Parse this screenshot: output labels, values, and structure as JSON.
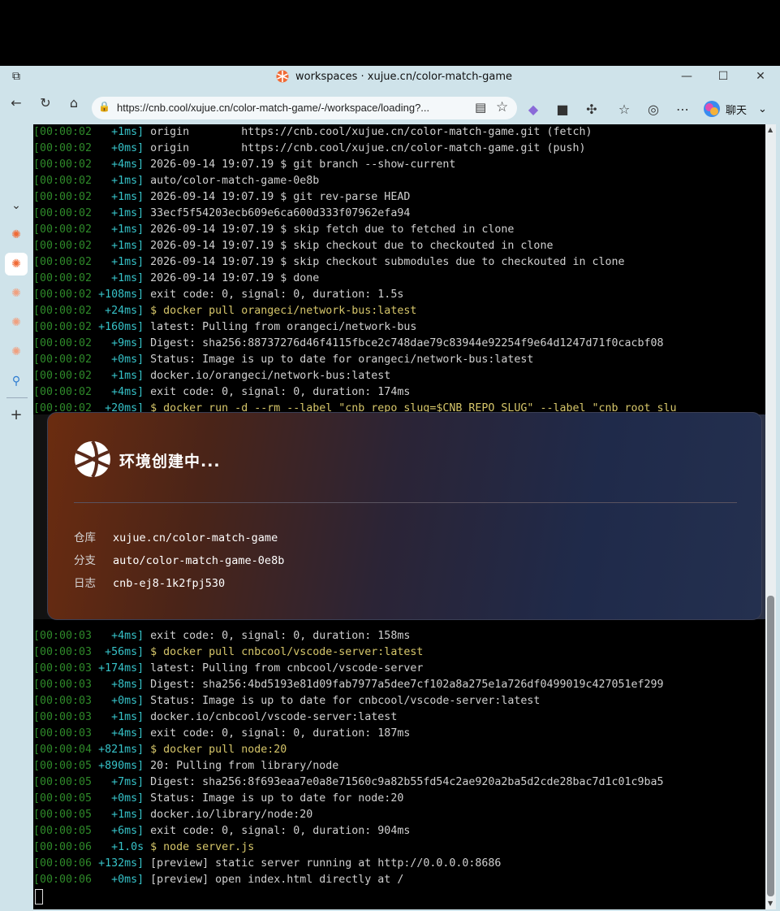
{
  "browser": {
    "tab_title": "workspaces · xujue.cn/color-match-game",
    "url": "https://cnb.cool/xujue.cn/color-match-game/-/workspace/loading?...",
    "copilot_label": "聊天"
  },
  "dialog": {
    "heading": "环境创建中...",
    "repo_label": "仓库",
    "repo_value": "xujue.cn/color-match-game",
    "branch_label": "分支",
    "branch_value": "auto/color-match-game-0e8b",
    "log_label": "日志",
    "log_value": "cnb-ej8-1k2fpj530"
  },
  "terminal": {
    "lines_top": [
      {
        "ts": "[00:00:02",
        "du": "  +1ms]",
        "text": " origin        https://cnb.cool/xujue.cn/color-match-game.git (fetch)",
        "cmd": false
      },
      {
        "ts": "[00:00:02",
        "du": "  +0ms]",
        "text": " origin        https://cnb.cool/xujue.cn/color-match-game.git (push)",
        "cmd": false
      },
      {
        "ts": "[00:00:02",
        "du": "  +4ms]",
        "text": " 2026-09-14 19:07.19 $ git branch --show-current",
        "cmd": false
      },
      {
        "ts": "[00:00:02",
        "du": "  +1ms]",
        "text": " auto/color-match-game-0e8b",
        "cmd": false
      },
      {
        "ts": "[00:00:02",
        "du": "  +1ms]",
        "text": " 2026-09-14 19:07.19 $ git rev-parse HEAD",
        "cmd": false
      },
      {
        "ts": "[00:00:02",
        "du": "  +1ms]",
        "text": " 33ecf5f54203ecb609e6ca600d333f07962efa94",
        "cmd": false
      },
      {
        "ts": "[00:00:02",
        "du": "  +1ms]",
        "text": " 2026-09-14 19:07.19 $ skip fetch due to fetched in clone",
        "cmd": false
      },
      {
        "ts": "[00:00:02",
        "du": "  +1ms]",
        "text": " 2026-09-14 19:07.19 $ skip checkout due to checkouted in clone",
        "cmd": false
      },
      {
        "ts": "[00:00:02",
        "du": "  +1ms]",
        "text": " 2026-09-14 19:07.19 $ skip checkout submodules due to checkouted in clone",
        "cmd": false
      },
      {
        "ts": "[00:00:02",
        "du": "  +1ms]",
        "text": " 2026-09-14 19:07.19 $ done",
        "cmd": false
      },
      {
        "ts": "[00:00:02",
        "du": "+108ms]",
        "text": " exit code: 0, signal: 0, duration: 1.5s",
        "cmd": false
      },
      {
        "ts": "[00:00:02",
        "du": " +24ms]",
        "text": " $ docker pull orangeci/network-bus:latest",
        "cmd": true
      },
      {
        "ts": "[00:00:02",
        "du": "+160ms]",
        "text": " latest: Pulling from orangeci/network-bus",
        "cmd": false
      },
      {
        "ts": "[00:00:02",
        "du": "  +9ms]",
        "text": " Digest: sha256:88737276d46f4115fbce2c748dae79c83944e92254f9e64d1247d71f0cacbf08",
        "cmd": false
      },
      {
        "ts": "[00:00:02",
        "du": "  +0ms]",
        "text": " Status: Image is up to date for orangeci/network-bus:latest",
        "cmd": false
      },
      {
        "ts": "[00:00:02",
        "du": "  +1ms]",
        "text": " docker.io/orangeci/network-bus:latest",
        "cmd": false
      },
      {
        "ts": "[00:00:02",
        "du": "  +4ms]",
        "text": " exit code: 0, signal: 0, duration: 174ms",
        "cmd": false
      },
      {
        "ts": "[00:00:02",
        "du": " +20ms]",
        "text": " $ docker run -d --rm --label \"cnb_repo_slug=$CNB_REPO_SLUG\" --label \"cnb_root_slu",
        "cmd": true
      }
    ],
    "lines_bottom": [
      {
        "ts": "[00:00:03",
        "du": "  +4ms]",
        "text": " exit code: 0, signal: 0, duration: 158ms",
        "cmd": false
      },
      {
        "ts": "[00:00:03",
        "du": " +56ms]",
        "text": " $ docker pull cnbcool/vscode-server:latest",
        "cmd": true
      },
      {
        "ts": "[00:00:03",
        "du": "+174ms]",
        "text": " latest: Pulling from cnbcool/vscode-server",
        "cmd": false
      },
      {
        "ts": "[00:00:03",
        "du": "  +8ms]",
        "text": " Digest: sha256:4bd5193e81d09fab7977a5dee7cf102a8a275e1a726df0499019c427051ef299",
        "cmd": false
      },
      {
        "ts": "[00:00:03",
        "du": "  +0ms]",
        "text": " Status: Image is up to date for cnbcool/vscode-server:latest",
        "cmd": false
      },
      {
        "ts": "[00:00:03",
        "du": "  +1ms]",
        "text": " docker.io/cnbcool/vscode-server:latest",
        "cmd": false
      },
      {
        "ts": "[00:00:03",
        "du": "  +4ms]",
        "text": " exit code: 0, signal: 0, duration: 187ms",
        "cmd": false
      },
      {
        "ts": "[00:00:04",
        "du": "+821ms]",
        "text": " $ docker pull node:20",
        "cmd": true
      },
      {
        "ts": "[00:00:05",
        "du": "+890ms]",
        "text": " 20: Pulling from library/node",
        "cmd": false
      },
      {
        "ts": "[00:00:05",
        "du": "  +7ms]",
        "text": " Digest: sha256:8f693eaa7e0a8e71560c9a82b55fd54c2ae920a2ba5d2cde28bac7d1c01c9ba5",
        "cmd": false
      },
      {
        "ts": "[00:00:05",
        "du": "  +0ms]",
        "text": " Status: Image is up to date for node:20",
        "cmd": false
      },
      {
        "ts": "[00:00:05",
        "du": "  +1ms]",
        "text": " docker.io/library/node:20",
        "cmd": false
      },
      {
        "ts": "[00:00:05",
        "du": "  +6ms]",
        "text": " exit code: 0, signal: 0, duration: 904ms",
        "cmd": false
      },
      {
        "ts": "[00:00:06",
        "du": "  +1.0s]",
        "text": " $ node server.js",
        "cmd": true
      },
      {
        "ts": "[00:00:06",
        "du": "+132ms]",
        "text": " [preview] static server running at http://0.0.0.0:8686",
        "cmd": false
      },
      {
        "ts": "[00:00:06",
        "du": "  +0ms]",
        "text": " [preview] open index.html directly at /",
        "cmd": false
      }
    ]
  }
}
